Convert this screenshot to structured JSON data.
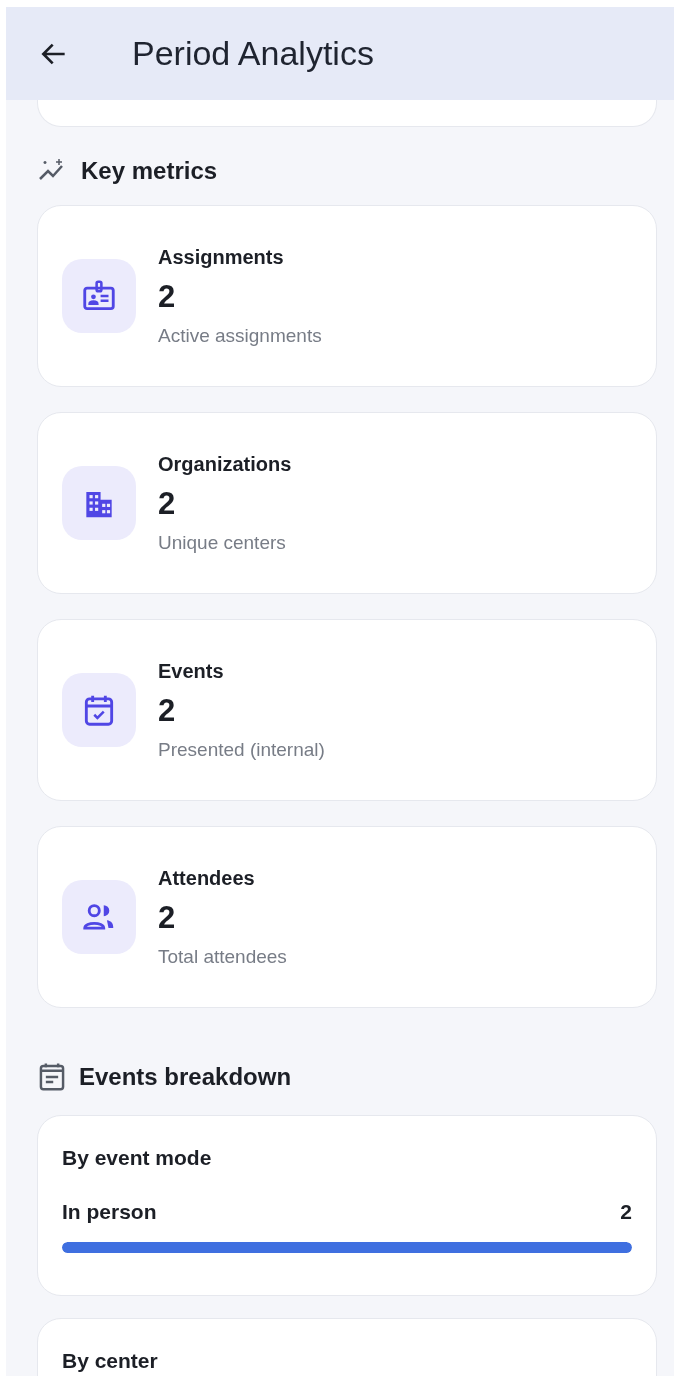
{
  "app_bar": {
    "title": "Period Analytics"
  },
  "key_metrics": {
    "heading": "Key metrics",
    "cards": [
      {
        "title": "Assignments",
        "value": "2",
        "caption": "Active assignments"
      },
      {
        "title": "Organizations",
        "value": "2",
        "caption": "Unique centers"
      },
      {
        "title": "Events",
        "value": "2",
        "caption": "Presented (internal)"
      },
      {
        "title": "Attendees",
        "value": "2",
        "caption": "Total attendees"
      }
    ]
  },
  "events_breakdown": {
    "heading": "Events breakdown",
    "cards": [
      {
        "title": "By event mode",
        "rows": [
          {
            "label": "In person",
            "count": "2",
            "level": 1
          }
        ]
      },
      {
        "title": "By center"
      }
    ]
  }
}
